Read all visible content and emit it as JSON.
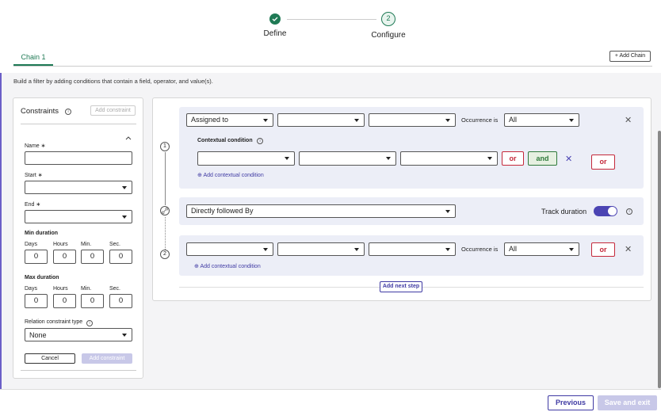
{
  "stepper": {
    "steps": [
      {
        "label": "Define",
        "status": "complete"
      },
      {
        "label": "Configure",
        "number": "2",
        "status": "current"
      }
    ]
  },
  "tabs": [
    {
      "label": "Chain 1"
    }
  ],
  "add_chain_label": "+ Add Chain",
  "hint": "Build a filter by adding conditions that contain a field, operator, and value(s).",
  "constraints": {
    "title": "Constraints",
    "add_constraint_header": "Add constraint",
    "name_label": "Name",
    "start_label": "Start",
    "end_label": "End",
    "required_mark": "∗",
    "min_duration": {
      "title": "Min duration",
      "labels": [
        "Days",
        "Hours",
        "Min.",
        "Sec."
      ],
      "values": [
        "0",
        "0",
        "0",
        "0"
      ]
    },
    "max_duration": {
      "title": "Max duration",
      "labels": [
        "Days",
        "Hours",
        "Min.",
        "Sec."
      ],
      "values": [
        "0",
        "0",
        "0",
        "0"
      ]
    },
    "relation_label": "Relation constraint type",
    "relation_value": "None",
    "cancel": "Cancel",
    "add_constraint": "Add constraint"
  },
  "chain": {
    "step1": {
      "number": "1",
      "field": "Assigned to",
      "occurrence_label": "Occurrence is",
      "occurrence_value": "All",
      "contextual_title": "Contextual condition",
      "or": "or",
      "and": "and",
      "outer_or": "or",
      "add_contextual": "Add contextual condition"
    },
    "relation": {
      "value": "Directly followed By",
      "track_label": "Track duration",
      "track_on": true
    },
    "step2": {
      "number": "2",
      "occurrence_label": "Occurrence is",
      "occurrence_value": "All",
      "or": "or",
      "add_contextual": "Add contextual condition"
    },
    "add_next_step": "Add next step"
  },
  "footer": {
    "previous": "Previous",
    "save": "Save and exit"
  },
  "colors": {
    "brand": "#3f3aa3",
    "success": "#1f7a55",
    "danger": "#c4283a"
  }
}
